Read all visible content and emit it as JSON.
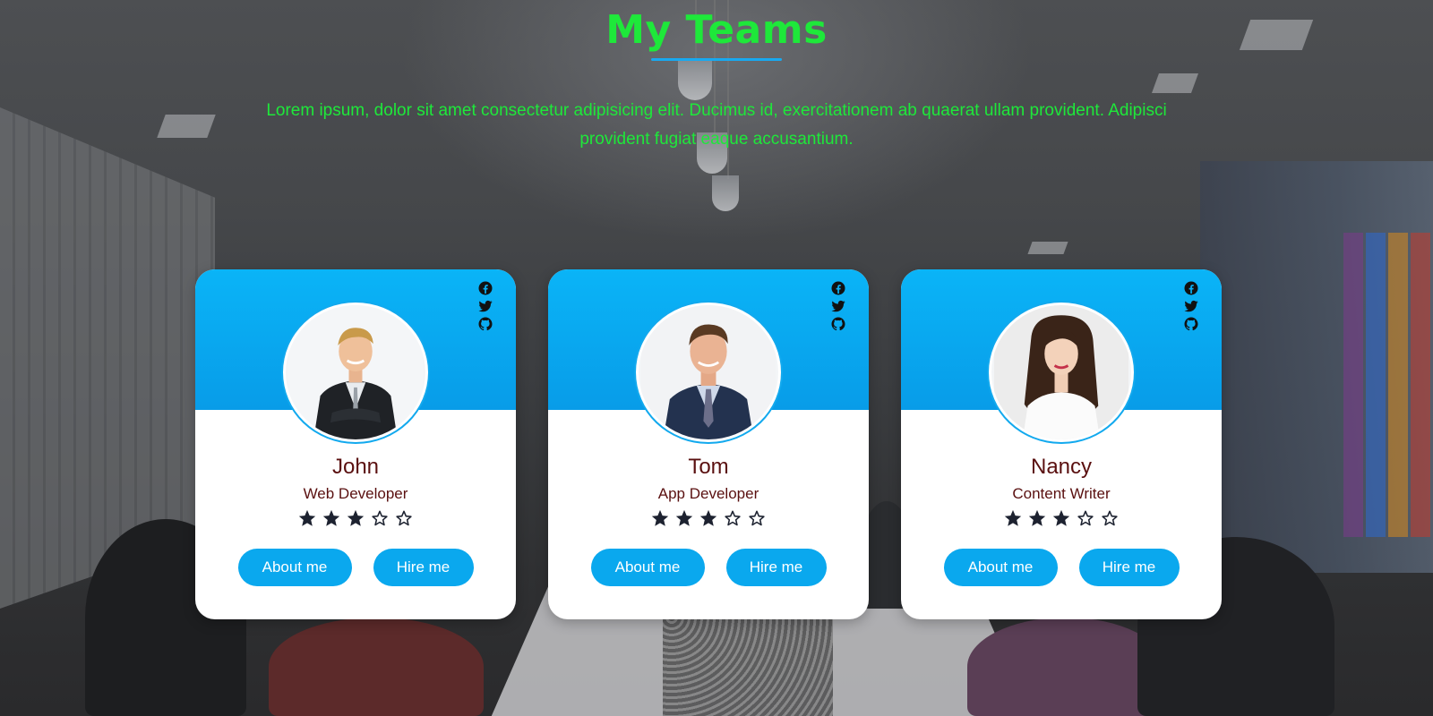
{
  "header": {
    "title": "My Teams",
    "description": "Lorem ipsum, dolor sit amet consectetur adipisicing elit. Ducimus id, exercitationem ab quaerat ullam provident. Adipisci provident fugiat eaque accusantium."
  },
  "colors": {
    "title": "#1ee83a",
    "accent": "#0aa8ee",
    "name_text": "#5a1010"
  },
  "social_icons": [
    "facebook-icon",
    "twitter-icon",
    "github-icon"
  ],
  "team": [
    {
      "name": "John",
      "role": "Web Developer",
      "rating": 3,
      "rating_max": 5,
      "about_label": "About me",
      "hire_label": "Hire me"
    },
    {
      "name": "Tom",
      "role": "App Developer",
      "rating": 3,
      "rating_max": 5,
      "about_label": "About me",
      "hire_label": "Hire me"
    },
    {
      "name": "Nancy",
      "role": "Content Writer",
      "rating": 3,
      "rating_max": 5,
      "about_label": "About me",
      "hire_label": "Hire me"
    }
  ]
}
